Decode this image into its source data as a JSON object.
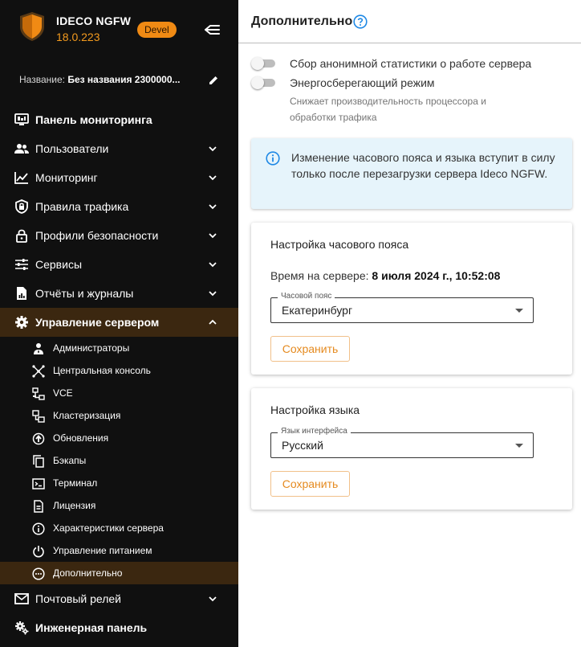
{
  "brand": {
    "name": "IDECO NGFW",
    "version": "18.0.223",
    "badge": "Devel"
  },
  "server": {
    "label": "Название:",
    "value": "Без названия 2300000..."
  },
  "sidebar": {
    "items": [
      {
        "label": "Панель мониторинга",
        "icon": "monitor-dashboard-icon"
      },
      {
        "label": "Пользователи",
        "icon": "users-icon"
      },
      {
        "label": "Мониторинг",
        "icon": "chart-line-icon"
      },
      {
        "label": "Правила трафика",
        "icon": "shield-lock-icon"
      },
      {
        "label": "Профили безопасности",
        "icon": "lock-icon"
      },
      {
        "label": "Сервисы",
        "icon": "sliders-icon"
      },
      {
        "label": "Отчёты и журналы",
        "icon": "report-icon"
      },
      {
        "label": "Управление сервером",
        "icon": "gear-icon"
      }
    ],
    "subitems": [
      {
        "label": "Администраторы",
        "icon": "admin-icon"
      },
      {
        "label": "Центральная консоль",
        "icon": "network-icon"
      },
      {
        "label": "VCE",
        "icon": "vce-icon"
      },
      {
        "label": "Кластеризация",
        "icon": "cluster-icon"
      },
      {
        "label": "Обновления",
        "icon": "update-icon"
      },
      {
        "label": "Бэкапы",
        "icon": "copy-icon"
      },
      {
        "label": "Терминал",
        "icon": "terminal-icon"
      },
      {
        "label": "Лицензия",
        "icon": "document-icon"
      },
      {
        "label": "Характеристики сервера",
        "icon": "info-icon"
      },
      {
        "label": "Управление питанием",
        "icon": "power-icon"
      },
      {
        "label": "Дополнительно",
        "icon": "more-icon"
      }
    ],
    "bottom": [
      {
        "label": "Почтовый релей",
        "icon": "mail-icon"
      },
      {
        "label": "Инженерная панель",
        "icon": "gears-icon"
      }
    ]
  },
  "main": {
    "title": "Дополнительно",
    "toggles": [
      {
        "label": "Сбор анонимной статистики о работе сервера",
        "on": false
      },
      {
        "label": "Энергосберегающий режим",
        "on": false
      }
    ],
    "power_hint": "Снижает производительность процессора и обработки трафика",
    "info_text": "Изменение часового пояса и языка вступит в силу только после перезагрузки сервера Ideco NGFW.",
    "timezone_card": {
      "title": "Настройка часового пояса",
      "time_label": "Время на сервере:",
      "time_value": "8 июля 2024 г., 10:52:08",
      "select_label": "Часовой пояс",
      "select_value": "Екатеринбург",
      "save_label": "Сохранить"
    },
    "language_card": {
      "title": "Настройка языка",
      "select_label": "Язык интерфейса",
      "select_value": "Русский",
      "save_label": "Сохранить"
    }
  },
  "colors": {
    "sidebar_bg": "#101010",
    "accent": "#f08a14",
    "active_bg": "#3b2710",
    "info_bg": "#e6f4fb",
    "help_blue": "#1e88e5"
  }
}
